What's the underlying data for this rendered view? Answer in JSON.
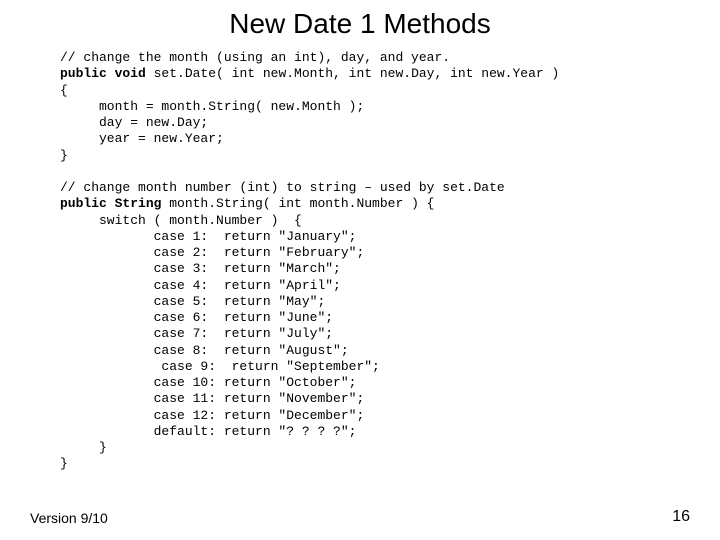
{
  "title": "New Date 1 Methods",
  "code": {
    "line1": "// change the month (using an int), day, and year.",
    "line2a": "public void",
    "line2b": " set.Date( int new.Month, int new.Day, int new.Year )",
    "line3": "{",
    "line4": "     month = month.String( new.Month );",
    "line5": "     day = new.Day;",
    "line6": "     year = new.Year;",
    "line7": "}",
    "blank1": " ",
    "line8": "// change month number (int) to string – used by set.Date",
    "line9a": "public String",
    "line9b": " month.String( int month.Number ) {",
    "line10": "     switch ( month.Number )  {",
    "line11": "            case 1:  return \"January\";",
    "line12": "            case 2:  return \"February\";",
    "line13": "            case 3:  return \"March\";",
    "line14": "            case 4:  return \"April\";",
    "line15": "            case 5:  return \"May\";",
    "line16": "            case 6:  return \"June\";",
    "line17": "            case 7:  return \"July\";",
    "line18": "            case 8:  return \"August\";",
    "line19": "             case 9:  return \"September\";",
    "line20": "            case 10: return \"October\";",
    "line21": "            case 11: return \"November\";",
    "line22": "            case 12: return \"December\";",
    "line23": "            default: return \"? ? ? ?\";",
    "line24": "     }",
    "line25": "}"
  },
  "footer": {
    "version": "Version 9/10",
    "page": "16"
  }
}
